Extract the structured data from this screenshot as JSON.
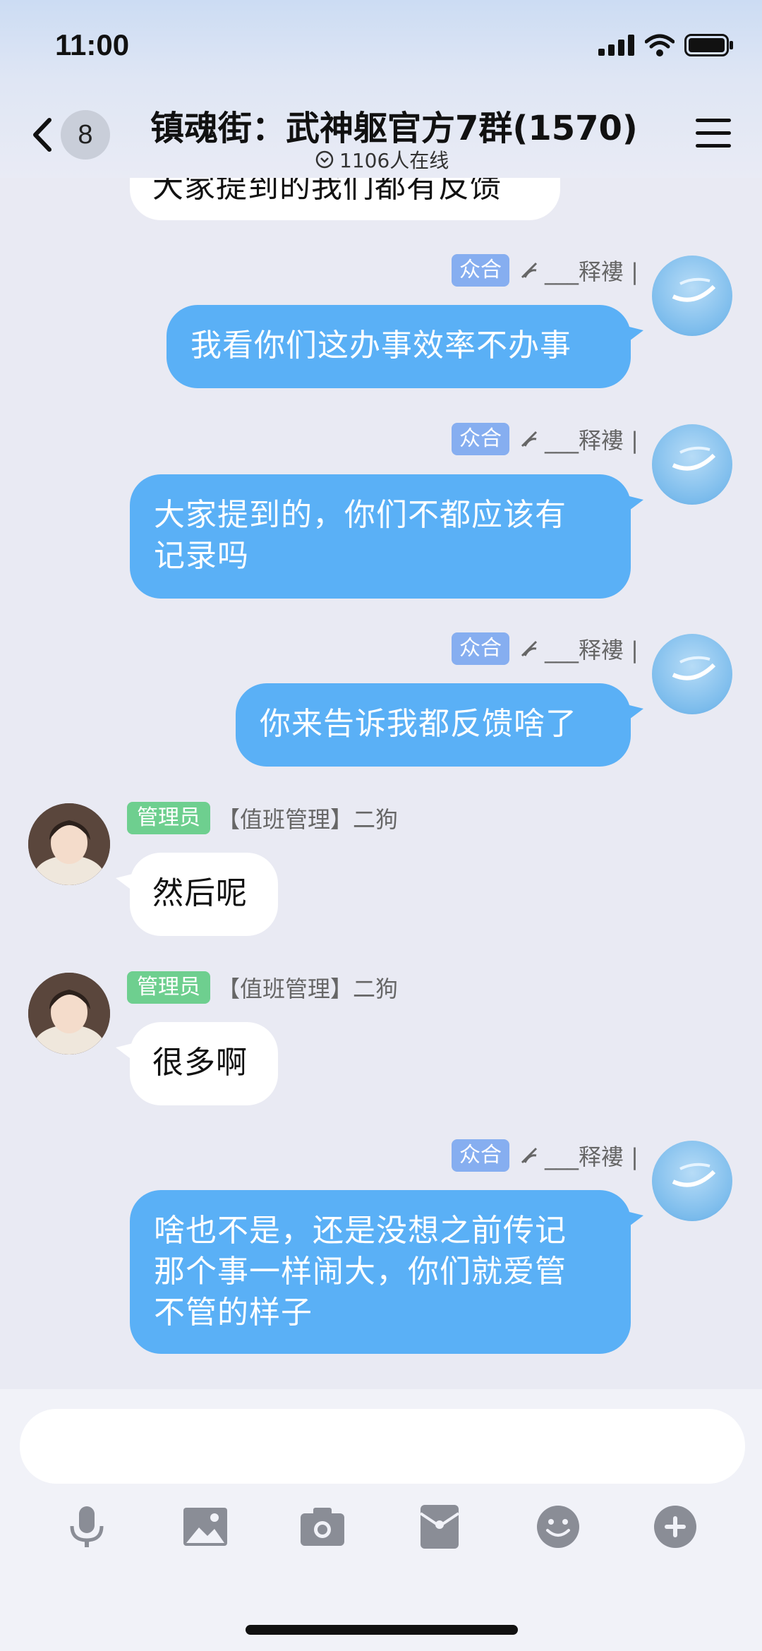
{
  "status_bar": {
    "time": "11:00"
  },
  "header": {
    "unread_count": "8",
    "group_title": "镇魂街：武神躯官方7群(1570)",
    "online_text": "1106人在线"
  },
  "cut_top_message": "大家提到的我们都有反馈",
  "messages": [
    {
      "side": "me",
      "tag": "众合",
      "sender": "___释褸 |",
      "text_lines": [
        "我看你们这办事效率不办事"
      ]
    },
    {
      "side": "me",
      "tag": "众合",
      "sender": "___释褸 |",
      "text_lines": [
        "大家提到的，你们不都应该有",
        "记录吗"
      ]
    },
    {
      "side": "me",
      "tag": "众合",
      "sender": "___释褸 |",
      "text_lines": [
        "你来告诉我都反馈啥了"
      ]
    },
    {
      "side": "them",
      "tag": "管理员",
      "sender": "【值班管理】二狗",
      "text_lines": [
        "然后呢"
      ]
    },
    {
      "side": "them",
      "tag": "管理员",
      "sender": "【值班管理】二狗",
      "text_lines": [
        "很多啊"
      ]
    },
    {
      "side": "me",
      "tag": "众合",
      "sender": "___释褸 |",
      "text_lines": [
        "啥也不是，还是没想之前传记",
        "那个事一样闹大，你们就爱管",
        "不管的样子"
      ]
    }
  ],
  "input": {
    "placeholder": ""
  },
  "toolbar": [
    "mic-icon",
    "image-icon",
    "camera-icon",
    "red-packet-icon",
    "emoji-icon",
    "plus-icon"
  ],
  "colors": {
    "my_bubble": "#5ab0f6",
    "their_bubble": "#ffffff",
    "tag_blue": "#86aef0",
    "tag_green": "#6ecf8f",
    "background": "#e9eaf3"
  }
}
